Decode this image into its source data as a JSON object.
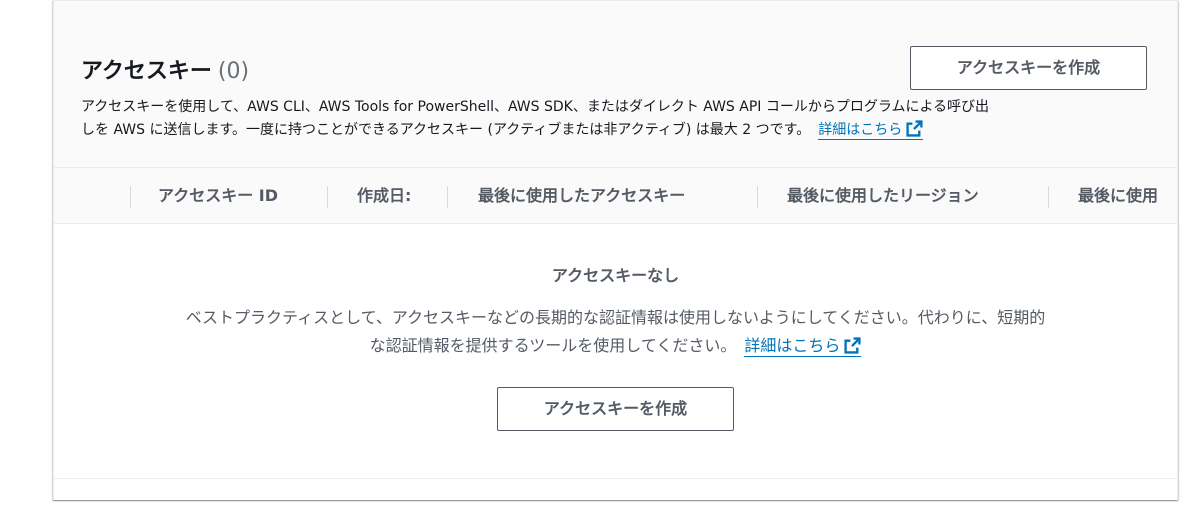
{
  "access_keys": {
    "title": "アクセスキー",
    "count": "(0)",
    "create_button_label": "アクセスキーを作成",
    "description_line1": "アクセスキーを使用して、AWS CLI、AWS Tools for PowerShell、AWS SDK、またはダイレクト AWS API コールからプログラムによる呼び出",
    "description_line2": "しを AWS に送信します。一度に持つことができるアクセスキー (アクティブまたは非アクティブ) は最大 2 つです。",
    "details_link": "詳細はこちら"
  },
  "table": {
    "columns": [
      "アクセスキー ID",
      "作成日:",
      "最後に使用したアクセスキー",
      "最後に使用したリージョン",
      "最後に使用"
    ]
  },
  "empty_state": {
    "title": "アクセスキーなし",
    "description_line1": "ベストプラクティスとして、アクセスキーなどの長期的な認証情報は使用しないようにしてください。代わりに、短期的",
    "description_line2": "な認証情報を提供するツールを使用してください。",
    "details_link": "詳細はこちら",
    "create_button_label": "アクセスキーを作成"
  },
  "colors": {
    "link": "#0073bb",
    "header_bg": "#fafafa",
    "button_border": "#545b64",
    "muted_text": "#687078"
  },
  "icons": {
    "external_link": "external-link-icon"
  }
}
